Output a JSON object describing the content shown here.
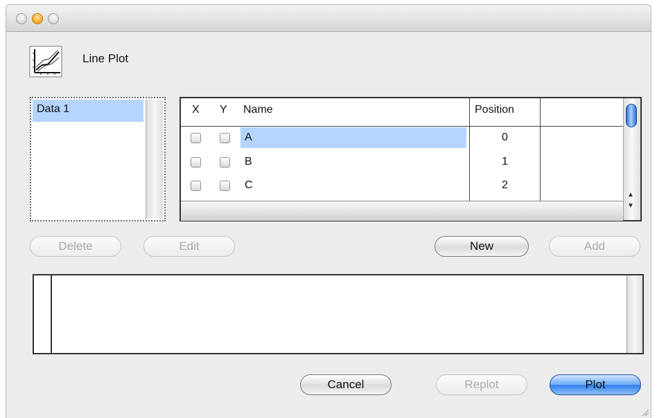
{
  "header": {
    "title": "Line Plot",
    "icon": "line-plot-icon"
  },
  "data_list": {
    "items": [
      "Data 1"
    ],
    "selected": 0
  },
  "table": {
    "columns": [
      "X",
      "Y",
      "Name",
      "Position"
    ],
    "rows": [
      {
        "x": false,
        "y": false,
        "name": "A",
        "position": "0"
      },
      {
        "x": false,
        "y": false,
        "name": "B",
        "position": "1"
      },
      {
        "x": false,
        "y": false,
        "name": "C",
        "position": "2"
      }
    ],
    "selected_row": 0
  },
  "list_buttons": {
    "delete": "Delete",
    "edit": "Edit",
    "new": "New",
    "add": "Add"
  },
  "footer_buttons": {
    "cancel": "Cancel",
    "replot": "Replot",
    "plot": "Plot"
  },
  "colors": {
    "selection": "#b5d5ff",
    "default_button": "#2f7de8",
    "window": "#ececec"
  }
}
